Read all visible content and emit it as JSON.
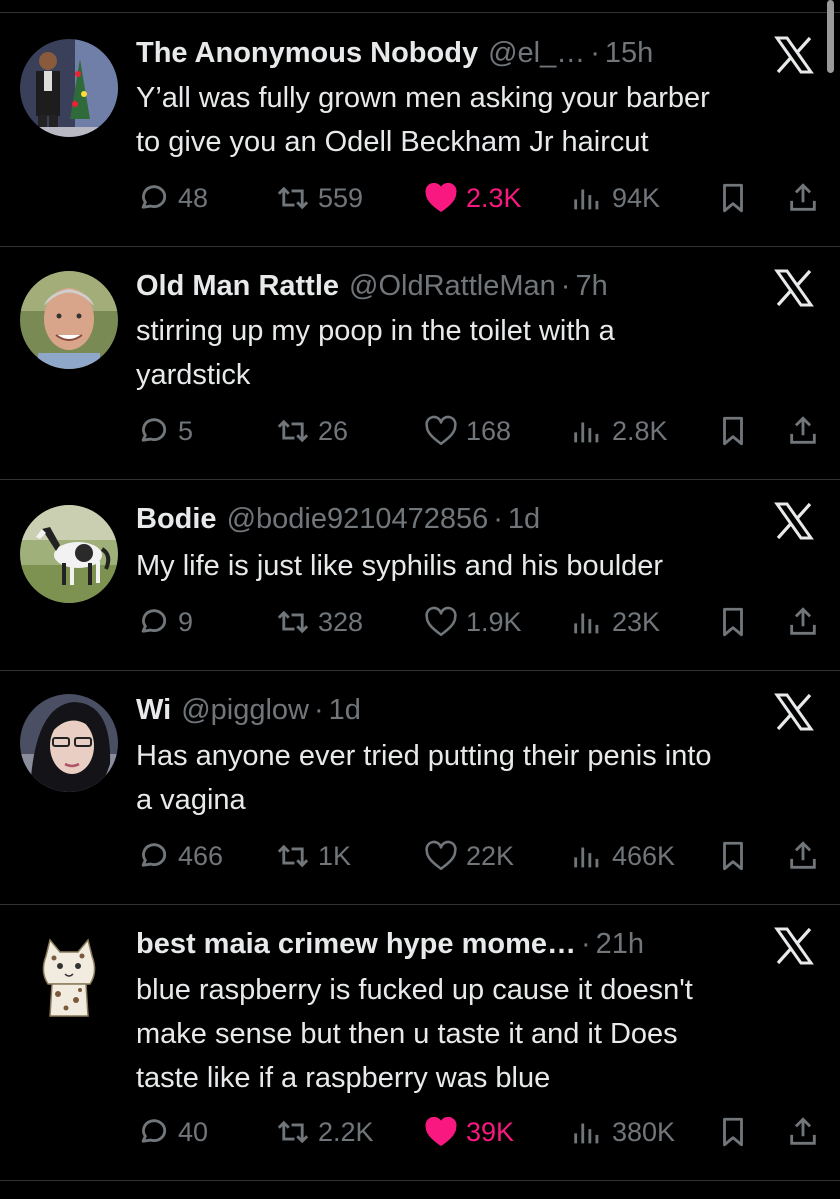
{
  "tweets": [
    {
      "name": "The Anonymous Nobody",
      "handle": "@el_…",
      "time": "15h",
      "text": "Y’all was fully grown men asking your barber\nto give you an Odell Beckham Jr haircut",
      "replies": "48",
      "reposts": "559",
      "likes": "2.3K",
      "liked": true,
      "views": "94K"
    },
    {
      "name": "Old Man Rattle",
      "handle": "@OldRattleMan",
      "time": "7h",
      "text": "stirring up my poop in the toilet with a\nyardstick",
      "replies": "5",
      "reposts": "26",
      "likes": "168",
      "liked": false,
      "views": "2.8K"
    },
    {
      "name": "Bodie",
      "handle": "@bodie9210472856",
      "time": "1d",
      "text": "My life is just like syphilis and his boulder",
      "replies": "9",
      "reposts": "328",
      "likes": "1.9K",
      "liked": false,
      "views": "23K"
    },
    {
      "name": "Wi",
      "handle": "@pigglow",
      "time": "1d",
      "text": "Has anyone ever tried putting their penis into\na vagina",
      "replies": "466",
      "reposts": "1K",
      "likes": "22K",
      "liked": false,
      "views": "466K"
    },
    {
      "name": "best maia crimew hype mome…",
      "handle": "",
      "time": "21h",
      "text": "blue raspberry is fucked up cause it doesn't\nmake sense but then u taste it and it Does\ntaste like if a raspberry was blue",
      "replies": "40",
      "reposts": "2.2K",
      "likes": "39K",
      "liked": true,
      "views": "380K"
    }
  ],
  "colors": {
    "background": "#000000",
    "text": "#e7e9ea",
    "muted": "#71767b",
    "divider": "#2f3336",
    "like": "#f91880"
  },
  "icons": [
    "reply-icon",
    "repost-icon",
    "like-icon",
    "views-icon",
    "bookmark-icon",
    "share-icon",
    "x-logo-icon"
  ]
}
